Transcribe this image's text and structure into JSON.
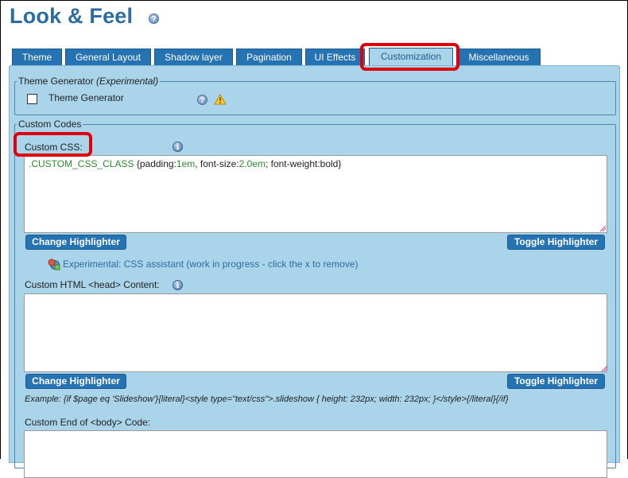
{
  "page": {
    "title": "Look & Feel",
    "help_glyph": "?"
  },
  "tabs": [
    {
      "label": "Theme"
    },
    {
      "label": "General Layout"
    },
    {
      "label": "Shadow layer"
    },
    {
      "label": "Pagination"
    },
    {
      "label": "UI Effects"
    },
    {
      "label": "Customization",
      "active": true
    },
    {
      "label": "Miscellaneous"
    }
  ],
  "theme_generator": {
    "legend_prefix": "Theme Generator ",
    "legend_note": "(Experimental)",
    "checkbox_label": "Theme Generator",
    "checked": false
  },
  "custom_codes": {
    "legend": "Custom Codes",
    "info_glyph": "i",
    "custom_css": {
      "label": "Custom CSS:",
      "code": {
        "selector": ".CUSTOM_CSS_CLASS",
        "p1": " {padding:",
        "v1": "1em",
        "p2": ", font-size:",
        "v2": "2.0em",
        "p3": "; font-weight:bold}"
      }
    },
    "change_highlighter": "Change Highlighter",
    "toggle_highlighter": "Toggle Highlighter",
    "css_assistant": "Experimental: CSS assistant (work in progress - click the x to remove)",
    "head_content": {
      "label": "Custom HTML <head> Content:",
      "value": ""
    },
    "example": "Example: {if $page eq 'Slideshow'}{literal}<style type=\"text/css\">.slideshow { height: 232px; width: 232px; }</style>{/literal}{/if}",
    "body_end": {
      "label": "Custom End of <body> Code:",
      "value": ""
    }
  },
  "colors": {
    "tab_bg": "#2673b4",
    "panel_bg": "#a9d4ea",
    "highlight": "#e0000b",
    "title": "#2d6ca2"
  }
}
